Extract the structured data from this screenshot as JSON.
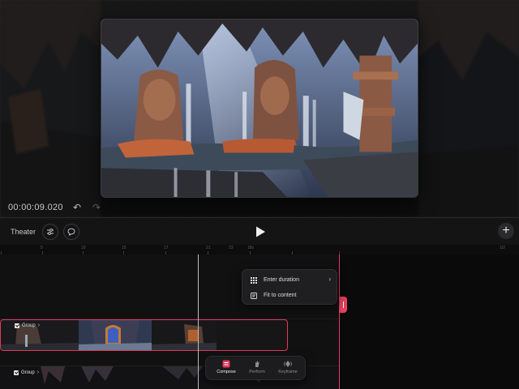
{
  "preview": {
    "timecode": "00:00:09.020"
  },
  "toolbar": {
    "theater_label": "Theater"
  },
  "timeline": {
    "ruler_labels": [
      "5",
      "10",
      "15",
      "17",
      "21",
      "23",
      "18s",
      "1/2"
    ],
    "groups": [
      {
        "label": "Group"
      },
      {
        "label": "Group"
      }
    ]
  },
  "context_menu": {
    "items": [
      {
        "label": "Enter duration",
        "icon": "grid-icon",
        "has_submenu": true
      },
      {
        "label": "Fit to content",
        "icon": "fit-content-icon",
        "has_submenu": false
      }
    ]
  },
  "modes": [
    {
      "label": "Compose",
      "icon": "compose-icon",
      "active": true
    },
    {
      "label": "Perform",
      "icon": "hand-icon",
      "active": false
    },
    {
      "label": "Keyframe",
      "icon": "keyframe-icon",
      "active": false
    }
  ],
  "colors": {
    "accent": "#e2395c",
    "background": "#0e0e0f",
    "panel": "#1f1f21"
  }
}
